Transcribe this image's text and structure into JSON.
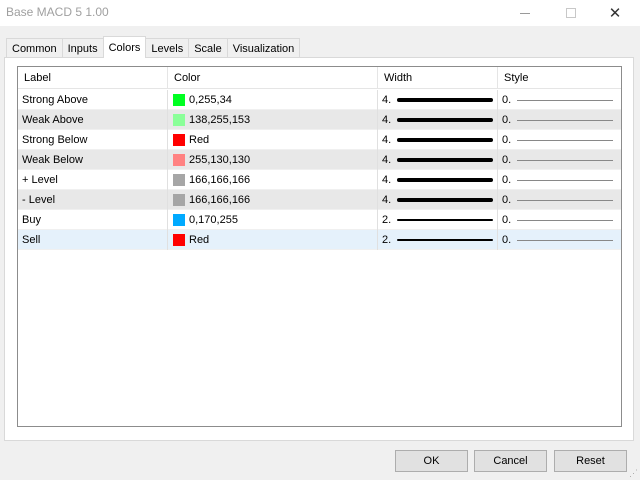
{
  "window": {
    "title": "Base MACD 5 1.00",
    "close_glyph": "✕"
  },
  "tabs": [
    {
      "label": "Common"
    },
    {
      "label": "Inputs"
    },
    {
      "label": "Colors",
      "active": true
    },
    {
      "label": "Levels"
    },
    {
      "label": "Scale"
    },
    {
      "label": "Visualization"
    }
  ],
  "table": {
    "headers": [
      "Label",
      "Color",
      "Width",
      "Style"
    ],
    "rows": [
      {
        "label": "Strong Above",
        "color_text": "0,255,34",
        "swatch": "#00ff22",
        "width": "4.",
        "style": "0."
      },
      {
        "label": "Weak Above",
        "color_text": "138,255,153",
        "swatch": "#8aff99",
        "width": "4.",
        "style": "0."
      },
      {
        "label": "Strong Below",
        "color_text": "Red",
        "swatch": "#ff0000",
        "width": "4.",
        "style": "0."
      },
      {
        "label": "Weak Below",
        "color_text": "255,130,130",
        "swatch": "#ff8282",
        "width": "4.",
        "style": "0."
      },
      {
        "label": "+ Level",
        "color_text": "166,166,166",
        "swatch": "#a6a6a6",
        "width": "4.",
        "style": "0."
      },
      {
        "label": "- Level",
        "color_text": "166,166,166",
        "swatch": "#a6a6a6",
        "width": "4.",
        "style": "0."
      },
      {
        "label": "Buy",
        "color_text": "0,170,255",
        "swatch": "#00aaff",
        "width": "2.",
        "style": "0."
      },
      {
        "label": "Sell",
        "color_text": "Red",
        "swatch": "#ff0000",
        "width": "2.",
        "style": "0."
      }
    ]
  },
  "buttons": {
    "ok": "OK",
    "cancel": "Cancel",
    "reset": "Reset"
  }
}
